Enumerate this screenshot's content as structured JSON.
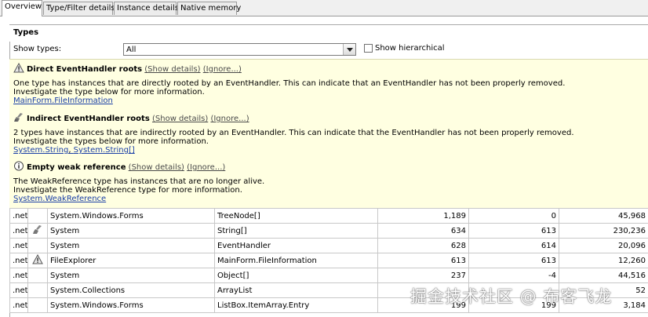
{
  "tabs": [
    "Overview",
    "Type/Filter details",
    "Instance details",
    "Native memory"
  ],
  "types_section": {
    "title": "Types",
    "show_types_label": "Show types:",
    "show_types_value": "All",
    "show_hierarchical_label": "Show hierarchical",
    "show_hierarchical_checked": false
  },
  "warnings": [
    {
      "icon": "warning-triangle-icon",
      "title": "Direct EventHandler roots",
      "show_details": "(Show details)",
      "ignore": "(Ignore...)",
      "line1": "One type has instances that are directly rooted by an EventHandler. This can indicate that an EventHandler has not been properly removed.",
      "line2": "Investigate the type below for more information.",
      "links": [
        "MainForm.FileInformation"
      ]
    },
    {
      "icon": "broom-icon",
      "title": "Indirect EventHandler roots",
      "show_details": "(Show details)",
      "ignore": "(Ignore...)",
      "line1": "2 types have instances that are indirectly rooted by an EventHandler. This can indicate that the EventHandler has not been properly removed.",
      "line2": "Investigate the types below for more information.",
      "links": [
        "System.String",
        "System.String[]"
      ]
    },
    {
      "icon": "info-icon",
      "title": "Empty weak reference",
      "show_details": "(Show details)",
      "ignore": "(Ignore...)",
      "line1": "The WeakReference type has instances that are no longer alive.",
      "line2": "Investigate the WeakReference type for more information.",
      "links": [
        "System.WeakReference"
      ]
    }
  ],
  "grid_rows": [
    {
      "net": ".net",
      "icon": "",
      "namespace": "System.Windows.Forms",
      "type": "TreeNode[]",
      "c1": "1,189",
      "c2": "0",
      "c3": "45,968"
    },
    {
      "net": ".net",
      "icon": "broom-icon",
      "namespace": "System",
      "type": "String[]",
      "c1": "634",
      "c2": "613",
      "c3": "230,236"
    },
    {
      "net": ".net",
      "icon": "",
      "namespace": "System",
      "type": "EventHandler",
      "c1": "628",
      "c2": "614",
      "c3": "20,096"
    },
    {
      "net": ".net",
      "icon": "warning-triangle-icon",
      "namespace": "FileExplorer",
      "type": "MainForm.FileInformation",
      "c1": "613",
      "c2": "613",
      "c3": "12,260"
    },
    {
      "net": ".net",
      "icon": "",
      "namespace": "System",
      "type": "Object[]",
      "c1": "237",
      "c2": "-4",
      "c3": "44,516"
    },
    {
      "net": ".net",
      "icon": "",
      "namespace": "System.Collections",
      "type": "ArrayList",
      "c1": "",
      "c2": "",
      "c3": "52"
    },
    {
      "net": ".net",
      "icon": "",
      "namespace": "System.Windows.Forms",
      "type": "ListBox.ItemArray.Entry",
      "c1": "199",
      "c2": "199",
      "c3": "3,184"
    }
  ],
  "watermark": "掘金技术社区 @ 布客飞龙",
  "colors": {
    "warning_bg": "#ffffe1",
    "link": "#1a3fa6"
  }
}
